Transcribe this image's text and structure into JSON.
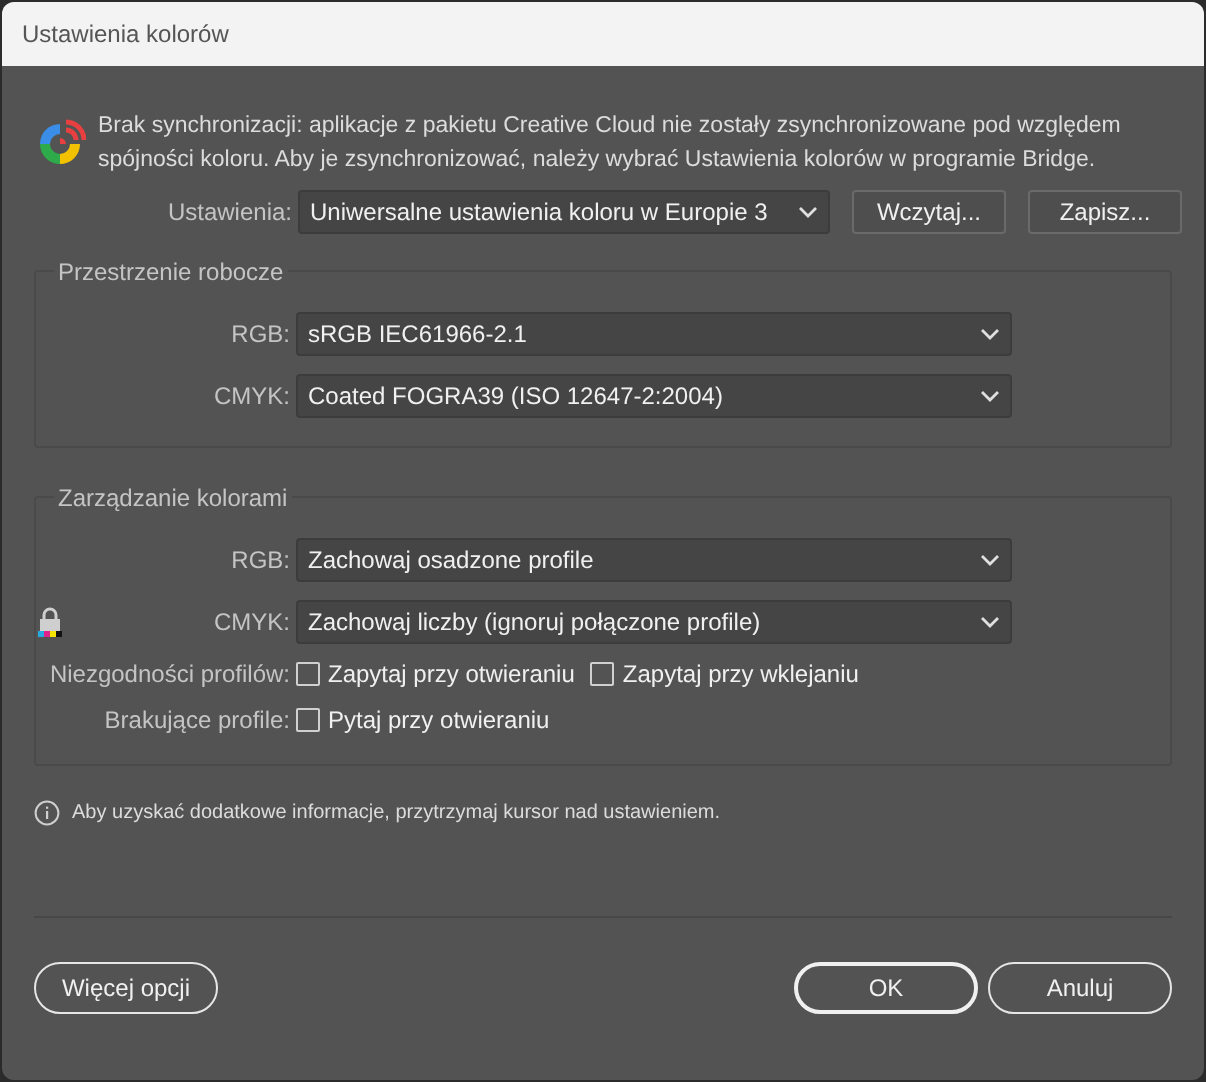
{
  "window": {
    "title": "Ustawienia kolorów"
  },
  "sync_message": "Brak synchronizacji: aplikacje z pakietu Creative Cloud nie zostały zsynchronizowane pod względem spójności koloru. Aby je zsynchronizować, należy wybrać Ustawienia kolorów w programie Bridge.",
  "settings": {
    "label": "Ustawienia:",
    "value": "Uniwersalne ustawienia koloru w Europie 3",
    "buttons": [
      "Wczytaj...",
      "Zapisz..."
    ]
  },
  "working_spaces": {
    "title": "Przestrzenie robocze",
    "rows": [
      {
        "label": "RGB:",
        "value": "sRGB IEC61966-2.1",
        "locked": false
      },
      {
        "label": "CMYK:",
        "value": "Coated FOGRA39 (ISO 12647-2:2004)",
        "locked": false
      }
    ]
  },
  "color_management": {
    "title": "Zarządzanie kolorami",
    "rows": [
      {
        "label": "RGB:",
        "value": "Zachowaj osadzone profile",
        "locked": false
      },
      {
        "label": "CMYK:",
        "value": "Zachowaj liczby (ignoruj połączone profile)",
        "locked": true
      }
    ],
    "checkbox_rows": [
      {
        "label": "Niezgodności profilów:",
        "options": [
          {
            "label": "Zapytaj przy otwieraniu",
            "checked": false
          },
          {
            "label": "Zapytaj przy wklejaniu",
            "checked": false
          }
        ]
      },
      {
        "label": "Brakujące profile:",
        "options": [
          {
            "label": "Pytaj przy otwieraniu",
            "checked": false
          }
        ]
      }
    ]
  },
  "info": "Aby uzyskać dodatkowe informacje, przytrzymaj kursor nad ustawieniem.",
  "buttons": {
    "more": "Więcej opcji",
    "ok": "OK",
    "cancel": "Anuluj"
  }
}
